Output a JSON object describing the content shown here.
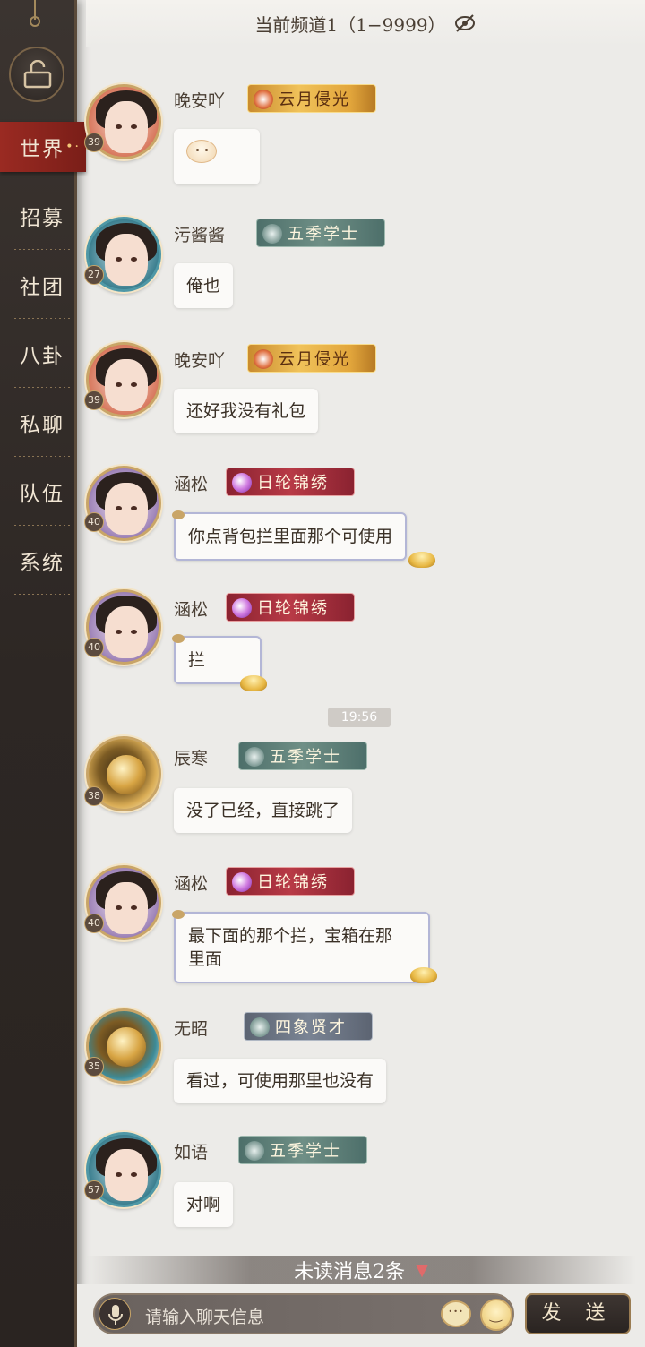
{
  "header": {
    "title": "当前频道1（1−9999）"
  },
  "nav": {
    "items": [
      {
        "label": "世界",
        "active": true
      },
      {
        "label": "招募"
      },
      {
        "label": "社团"
      },
      {
        "label": "八卦"
      },
      {
        "label": "私聊"
      },
      {
        "label": "队伍"
      },
      {
        "label": "系统"
      }
    ]
  },
  "messages": [
    {
      "name": "晚安吖",
      "level": "39",
      "title": "云月侵光",
      "text": "",
      "emoji": "face-emoji"
    },
    {
      "name": "污酱酱",
      "level": "27",
      "title": "五季学士",
      "text": "俺也"
    },
    {
      "name": "晚安吖",
      "level": "39",
      "title": "云月侵光",
      "text": "还好我没有礼包"
    },
    {
      "name": "涵松",
      "level": "40",
      "title": "日轮锦绣",
      "text": "你点背包拦里面那个可使用"
    },
    {
      "name": "涵松",
      "level": "40",
      "title": "日轮锦绣",
      "text": "拦"
    },
    {
      "name": "辰寒",
      "level": "38",
      "title": "五季学士",
      "text": "没了已经，直接跳了"
    },
    {
      "name": "涵松",
      "level": "40",
      "title": "日轮锦绣",
      "text_line1": "最下面的那个拦，宝箱在那",
      "text_line2": "里面"
    },
    {
      "name": "无昭",
      "level": "35",
      "title": "四象贤才",
      "text": "看过，可使用那里也没有"
    },
    {
      "name": "如语",
      "level": "57",
      "title": "五季学士",
      "text": "对啊"
    }
  ],
  "timestamp": "19:56",
  "unread": {
    "label": "未读消息2条"
  },
  "input": {
    "placeholder": "请输入聊天信息"
  },
  "send_label": "发 送"
}
